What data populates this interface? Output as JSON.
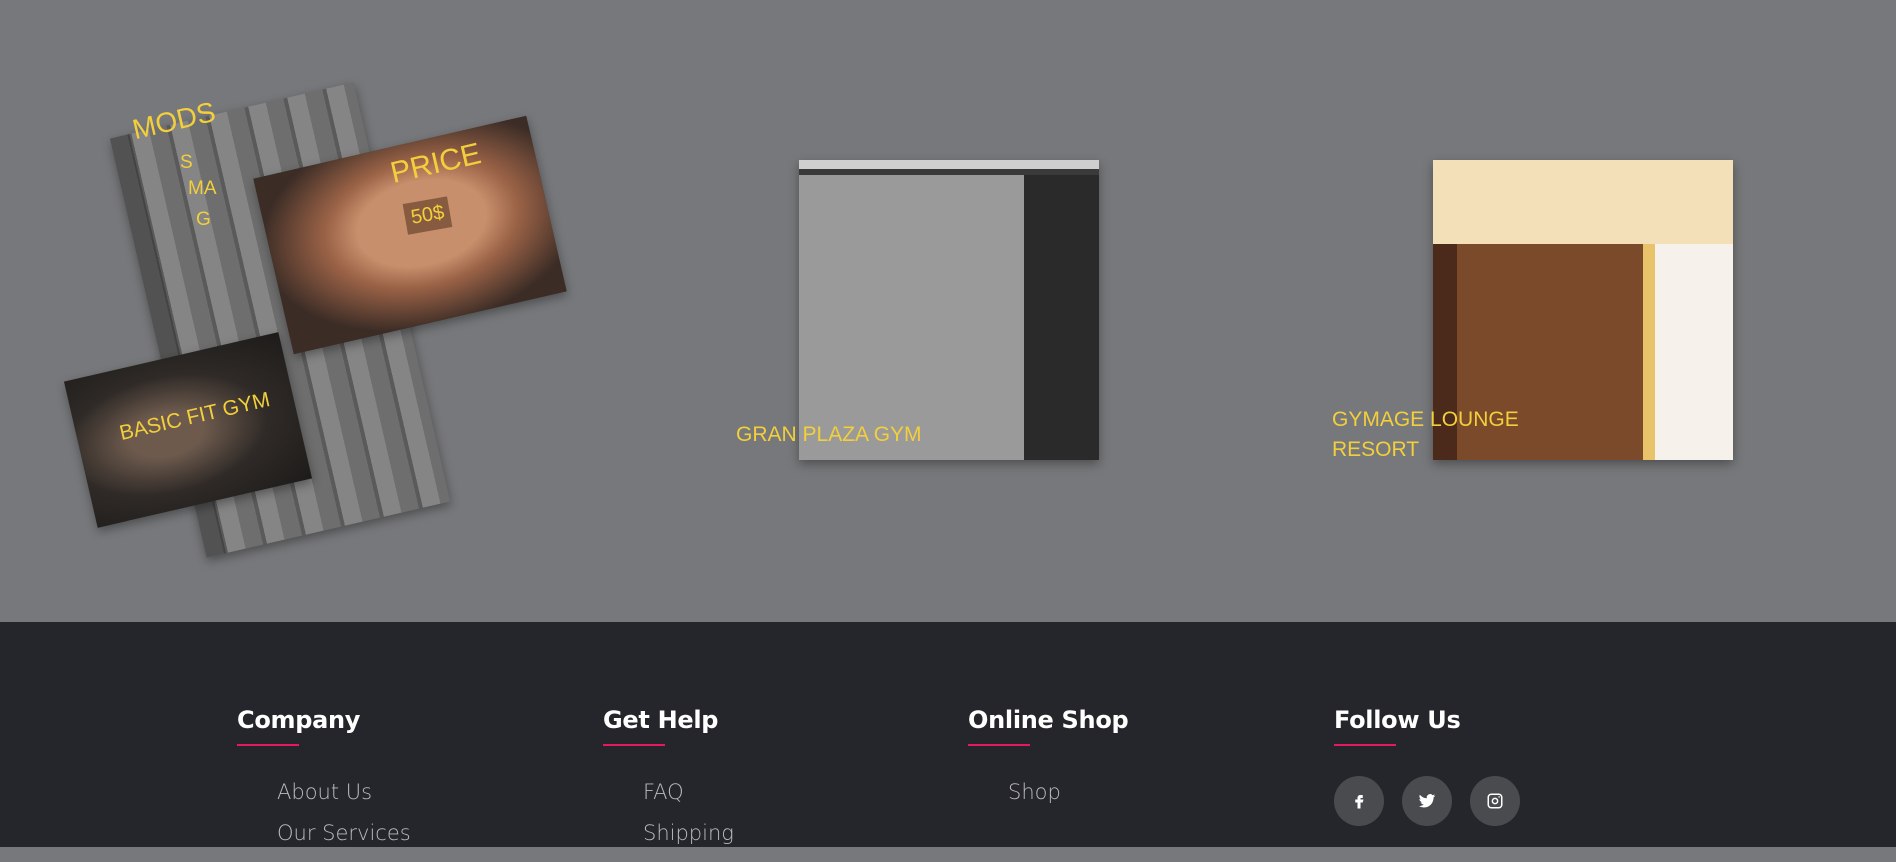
{
  "gallery": {
    "card1": {
      "title": "MODS",
      "title_letters": [
        "S",
        "MA",
        "G"
      ],
      "price_label": "PRICE",
      "price_value": "50$",
      "name": "BASIC FIT GYM"
    },
    "card2": {
      "name": "GRAN PLAZA GYM"
    },
    "card3": {
      "name_line1": "GYMAGE LOUNGE",
      "name_line2": "RESORT"
    }
  },
  "footer": {
    "columns": [
      {
        "heading": "Company",
        "links": [
          "About Us",
          "Our Services"
        ]
      },
      {
        "heading": "Get Help",
        "links": [
          "FAQ",
          "Shipping"
        ]
      },
      {
        "heading": "Online Shop",
        "links": [
          "Shop"
        ]
      },
      {
        "heading": "Follow Us"
      }
    ],
    "social": [
      "facebook-icon",
      "twitter-icon",
      "instagram-icon"
    ]
  },
  "colors": {
    "accent": "#e6195f",
    "caption": "#f2cf3b",
    "gallery_bg": "#77787b",
    "footer_bg": "#25262b"
  }
}
